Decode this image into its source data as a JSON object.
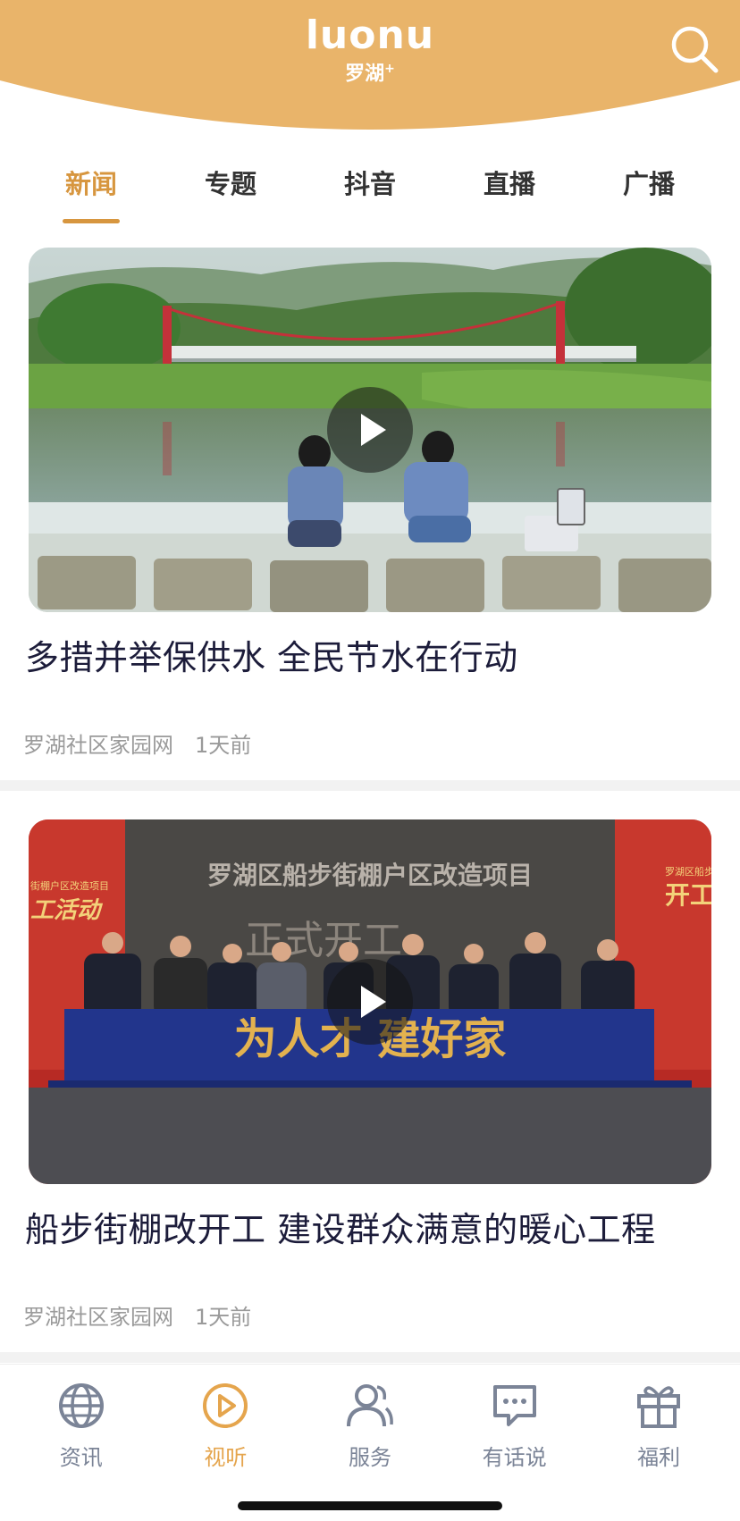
{
  "header": {
    "logo_mark": "luonu",
    "logo_sub": "罗湖",
    "logo_plus": "+",
    "brand_color": "#e9b46a"
  },
  "tabs": [
    {
      "label": "新闻",
      "active": true
    },
    {
      "label": "专题",
      "active": false
    },
    {
      "label": "抖音",
      "active": false
    },
    {
      "label": "直播",
      "active": false
    },
    {
      "label": "广播",
      "active": false
    }
  ],
  "articles": [
    {
      "title": "多措并举保供水 全民节水在行动",
      "source": "罗湖社区家园网",
      "time": "1天前",
      "media": "video"
    },
    {
      "title": "船步街棚改开工 建设群众满意的暖心工程",
      "source": "罗湖社区家园网",
      "time": "1天前",
      "media": "video",
      "image_text": {
        "backdrop_title": "罗湖区船步街棚户区改造项目",
        "backdrop_sub": "正式开工",
        "left_banner_small": "街棚户区改造项目",
        "left_banner_big": "工活动",
        "right_banner_small": "罗湖区船步",
        "right_banner_big": "开工",
        "stage_text": "为人才 建好家"
      }
    }
  ],
  "bottom_nav": [
    {
      "label": "资讯",
      "icon": "globe-icon",
      "active": false
    },
    {
      "label": "视听",
      "icon": "play-circle-icon",
      "active": true
    },
    {
      "label": "服务",
      "icon": "users-icon",
      "active": false
    },
    {
      "label": "有话说",
      "icon": "chat-icon",
      "active": false
    },
    {
      "label": "福利",
      "icon": "gift-icon",
      "active": false
    }
  ],
  "colors": {
    "accent": "#d7963f",
    "nav_active": "#e5a54d",
    "nav_inactive": "#7b8497"
  }
}
